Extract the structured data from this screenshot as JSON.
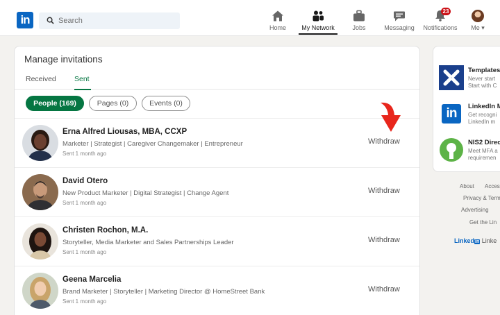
{
  "header": {
    "logo": "in",
    "search_placeholder": "Search",
    "nav": [
      {
        "label": "Home",
        "icon": "home-icon"
      },
      {
        "label": "My Network",
        "icon": "network-icon",
        "active": true
      },
      {
        "label": "Jobs",
        "icon": "briefcase-icon"
      },
      {
        "label": "Messaging",
        "icon": "chat-icon"
      },
      {
        "label": "Notifications",
        "icon": "bell-icon",
        "badge": "23"
      },
      {
        "label": "Me ▾",
        "icon": "avatar"
      }
    ]
  },
  "invitations": {
    "title": "Manage invitations",
    "tabs": [
      "Received",
      "Sent"
    ],
    "active_tab": "Sent",
    "filters": [
      "People (169)",
      "Pages (0)",
      "Events (0)"
    ],
    "withdraw_label": "Withdraw",
    "people": [
      {
        "name": "Erna Alfred Liousas, MBA, CCXP",
        "headline": "Marketer | Strategist | Caregiver Changemaker | Entrepreneur",
        "sent": "Sent 1 month ago"
      },
      {
        "name": "David Otero",
        "headline": "New Product Marketer | Digital Strategist | Change Agent",
        "sent": "Sent 1 month ago"
      },
      {
        "name": "Christen Rochon, M.A.",
        "headline": "Storyteller, Media Marketer and Sales Partnerships Leader",
        "sent": "Sent 1 month ago"
      },
      {
        "name": "Geena Marcelia",
        "headline": "Brand Marketer | Storyteller | Marketing Director @ HomeStreet Bank",
        "sent": "Sent 1 month ago"
      }
    ]
  },
  "rail": {
    "ads": [
      {
        "title": "Templates",
        "line1": "Never start",
        "line2": "Start with C"
      },
      {
        "title": "LinkedIn M",
        "line1": "Get recogni",
        "line2": "LinkedIn m"
      },
      {
        "title": "NIS2 Direc",
        "line1": "Meet MFA a",
        "line2": "requiremen"
      }
    ],
    "footer": [
      "About",
      "Acces",
      "Privacy & Term",
      "Advertising",
      "Get the Lin"
    ],
    "brand_in": "in",
    "brand_prefix": "Linked",
    "brand_rest": "Linke"
  },
  "colors": {
    "brand": "#0a66c2",
    "accent_green": "#057642",
    "badge_red": "#cc1016",
    "arrow_red": "#e8261c"
  }
}
